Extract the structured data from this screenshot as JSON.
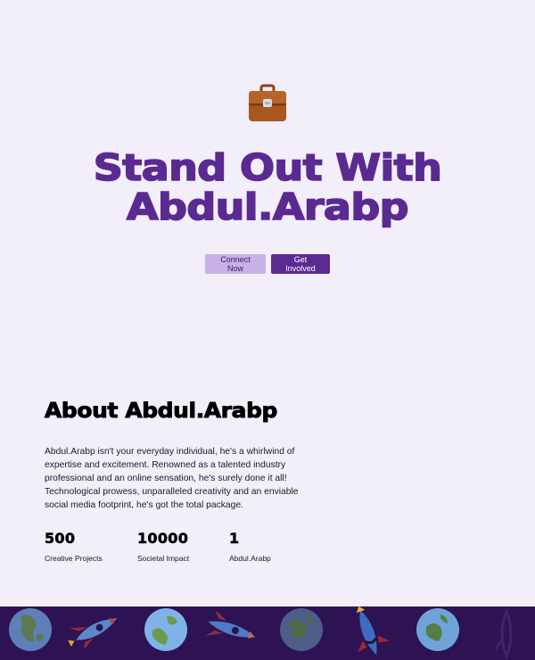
{
  "hero": {
    "icon": "briefcase-icon",
    "title_line1": "Stand Out With",
    "title_line2": "Abdul.Arabp",
    "connect_label": "Connect Now",
    "involved_label": "Get Involved"
  },
  "about": {
    "title": "About Abdul.Arabp",
    "text": "Abdul.Arabp isn't your everyday individual, he's a whirlwind of expertise and excitement. Renowned as a talented industry professional and an online sensation, he's surely done it all! Technological prowess, unparalleled creativity and an enviable social media footprint, he's got the total package.",
    "stats": [
      {
        "value": "500",
        "label": "Creative Projects"
      },
      {
        "value": "10000",
        "label": "Societal Impact"
      },
      {
        "value": "1",
        "label": "Abdul.Arabp"
      }
    ]
  },
  "footer": {
    "decor": [
      "earth-icon",
      "rocket-icon",
      "earth-icon",
      "rocket-icon",
      "earth-icon",
      "rocket-icon",
      "earth-icon",
      "rocket-icon"
    ]
  },
  "colors": {
    "background": "#f2eefa",
    "accent": "#5a2a91",
    "accent_light": "#c6b2e6",
    "footer": "#2d1354",
    "briefcase": "#a0521e"
  }
}
